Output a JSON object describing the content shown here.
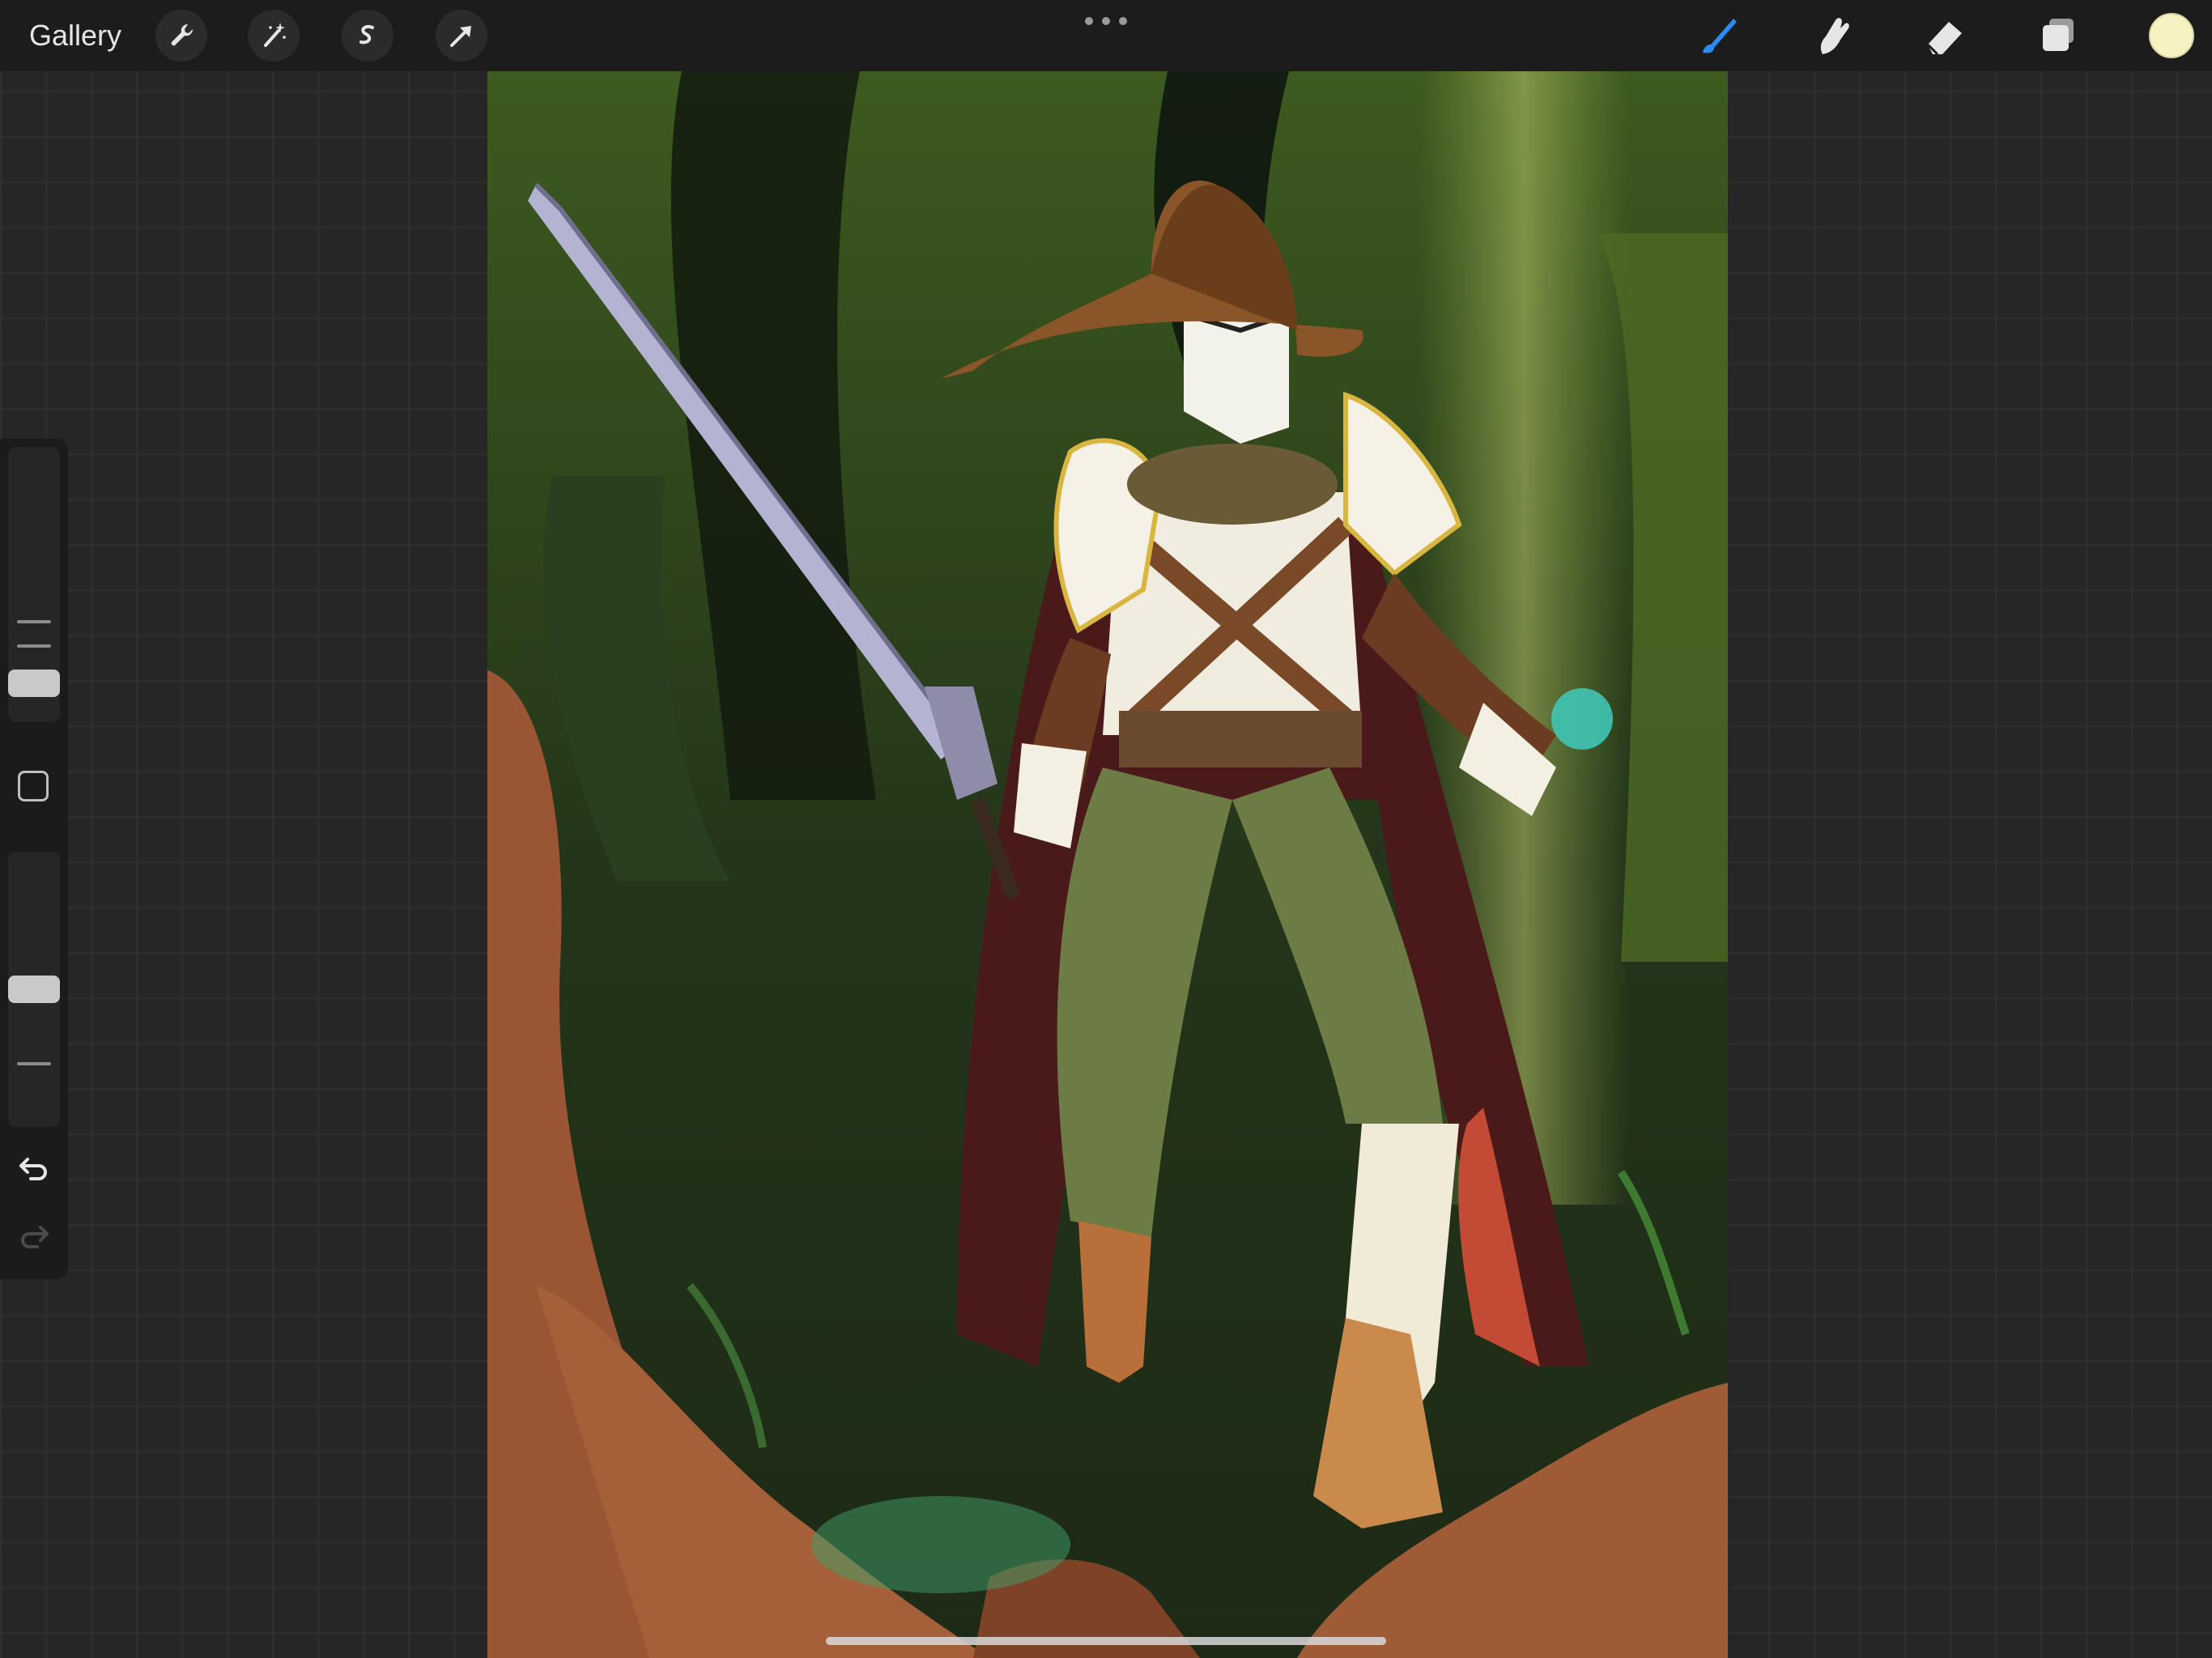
{
  "toolbar": {
    "gallery_label": "Gallery",
    "left_tools": [
      "wrench-icon",
      "magic-wand-icon",
      "selection-icon",
      "transform-arrow-icon"
    ],
    "right_tools": [
      "brush-icon",
      "smudge-icon",
      "eraser-icon",
      "layers-icon"
    ],
    "active_tool": "brush",
    "active_color": "#f7f2c2",
    "accent": "#2a8cf0"
  },
  "sidebar": {
    "brush_size_level": 0.1,
    "opacity_level": 0.5,
    "modify_button": "square-icon",
    "undo": "undo-icon",
    "redo": "redo-icon",
    "redo_enabled": false
  }
}
